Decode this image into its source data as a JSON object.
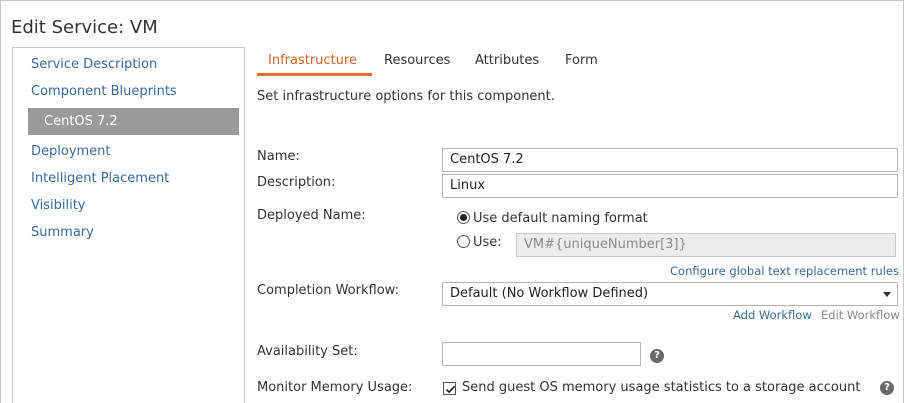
{
  "page": {
    "title": "Edit Service: VM"
  },
  "sidebar": {
    "items": [
      {
        "label": "Service Description"
      },
      {
        "label": "Component Blueprints"
      },
      {
        "label": "CentOS 7.2"
      },
      {
        "label": "Deployment"
      },
      {
        "label": "Intelligent Placement"
      },
      {
        "label": "Visibility"
      },
      {
        "label": "Summary"
      }
    ]
  },
  "tabs": [
    {
      "label": "Infrastructure",
      "active": true
    },
    {
      "label": "Resources",
      "active": false
    },
    {
      "label": "Attributes",
      "active": false
    },
    {
      "label": "Form",
      "active": false
    }
  ],
  "main": {
    "intro": "Set infrastructure options for this component.",
    "name": {
      "label": "Name:",
      "value": "CentOS 7.2"
    },
    "description": {
      "label": "Description:",
      "value": "Linux"
    },
    "deployed_name": {
      "label": "Deployed Name:",
      "option_default": "Use default naming format",
      "option_use": "Use:",
      "use_value": "VM#{uniqueNumber[3]}",
      "selected": "default"
    },
    "configure_link": "Configure global text replacement rules",
    "completion_workflow": {
      "label": "Completion Workflow:",
      "value": "Default (No Workflow Defined)",
      "add_link": "Add Workflow",
      "edit_link": "Edit Workflow"
    },
    "availability_set": {
      "label": "Availability Set:",
      "value": ""
    },
    "monitor_memory": {
      "label": "Monitor Memory Usage:",
      "checkbox_label": "Send guest OS memory usage statistics to a storage account",
      "checked": true
    }
  },
  "colors": {
    "accent": "#e46f35",
    "link": "#3a6a96",
    "selected_bg": "#9a9a9a"
  },
  "icons": {
    "help": "question-circle-icon",
    "dropdown": "chevron-down-icon",
    "check": "checkmark-icon"
  }
}
